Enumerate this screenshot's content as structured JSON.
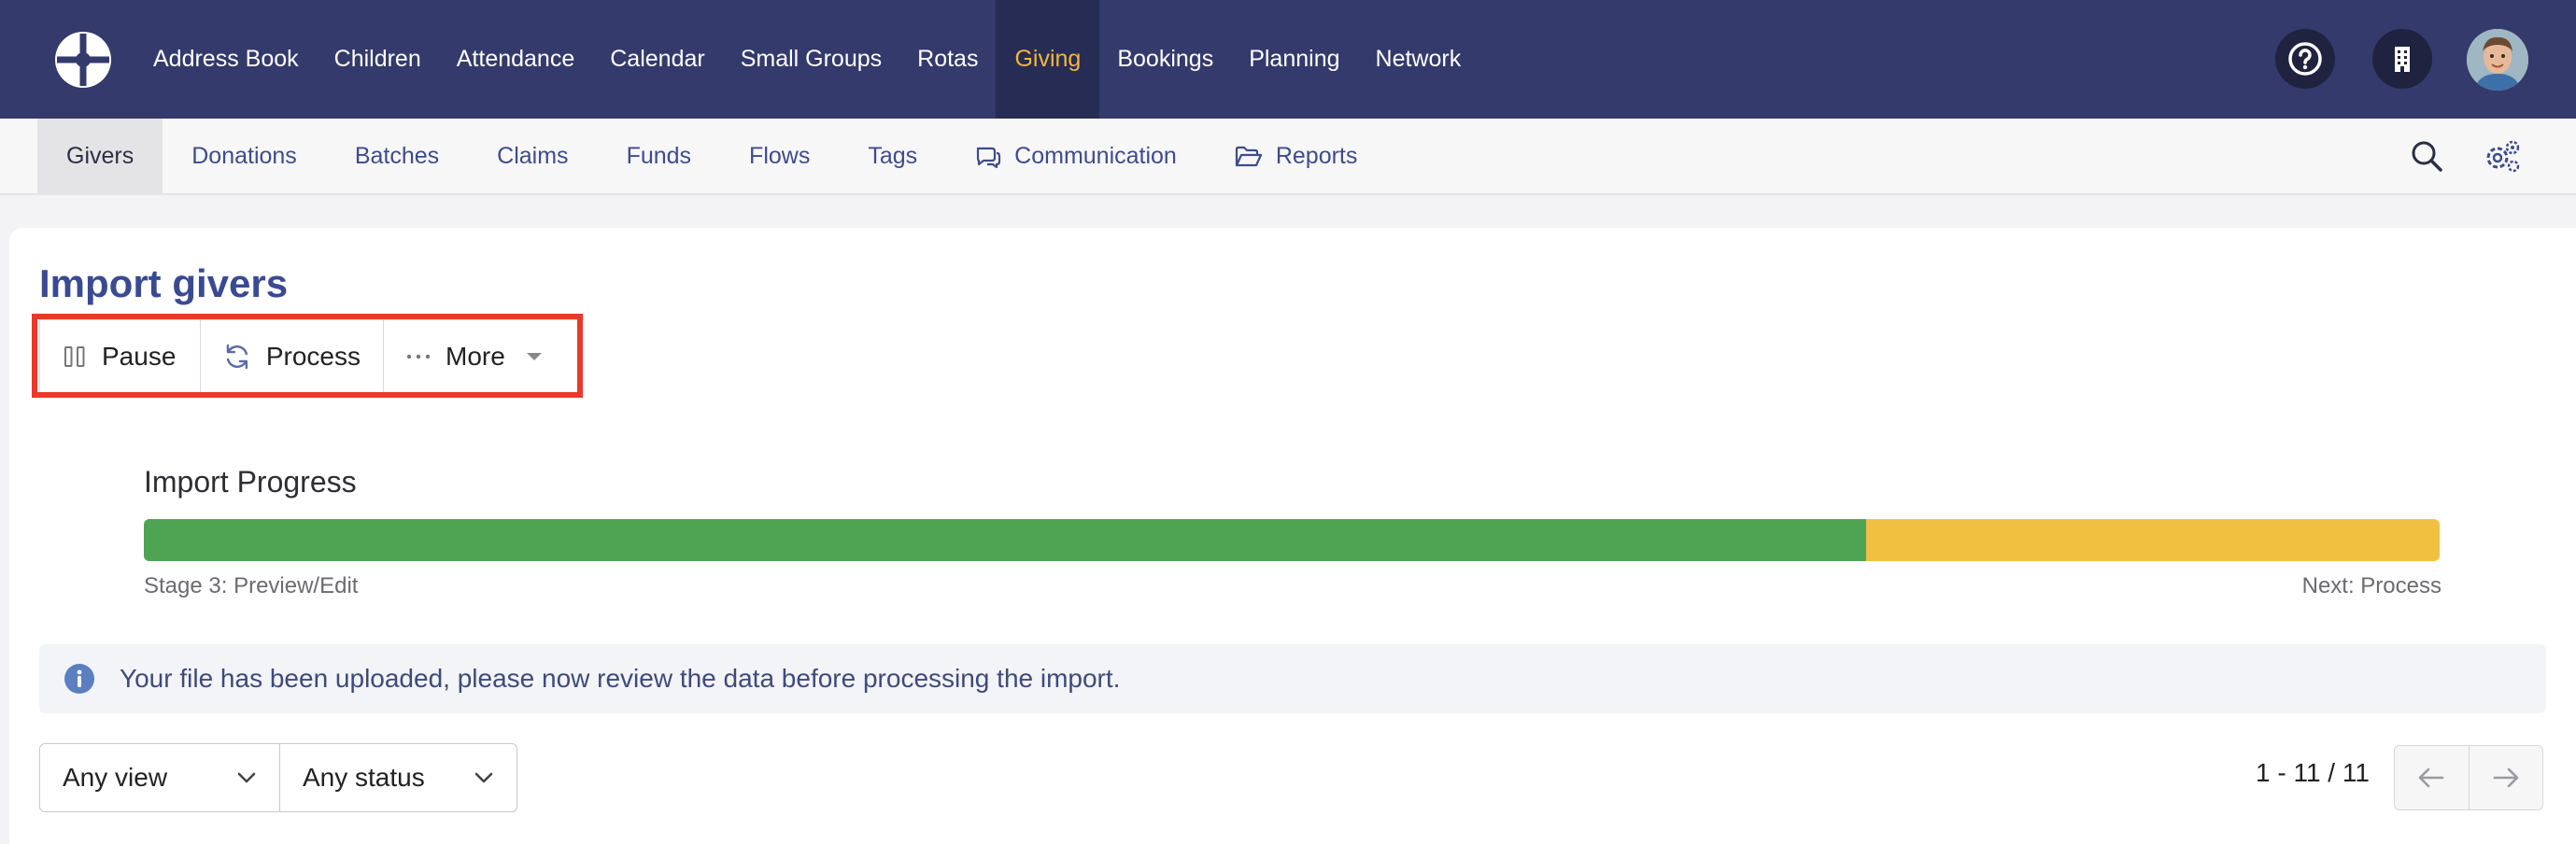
{
  "topnav": {
    "items": [
      {
        "label": "Address Book"
      },
      {
        "label": "Children"
      },
      {
        "label": "Attendance"
      },
      {
        "label": "Calendar"
      },
      {
        "label": "Small Groups"
      },
      {
        "label": "Rotas"
      },
      {
        "label": "Giving",
        "active": true
      },
      {
        "label": "Bookings"
      },
      {
        "label": "Planning"
      },
      {
        "label": "Network"
      }
    ],
    "icons": [
      "help-icon",
      "building-icon",
      "avatar"
    ],
    "active_color": "#f2b63c",
    "background": "#343a6b"
  },
  "subnav": {
    "items": [
      {
        "label": "Givers",
        "active": true
      },
      {
        "label": "Donations"
      },
      {
        "label": "Batches"
      },
      {
        "label": "Claims"
      },
      {
        "label": "Funds"
      },
      {
        "label": "Flows"
      },
      {
        "label": "Tags"
      },
      {
        "label": "Communication",
        "icon": "chat-icon"
      },
      {
        "label": "Reports",
        "icon": "folder-open-icon"
      }
    ],
    "right_icons": [
      "search-icon",
      "settings-icon"
    ]
  },
  "page": {
    "title": "Import givers"
  },
  "toolbar": {
    "pause_label": "Pause",
    "process_label": "Process",
    "more_label": "More"
  },
  "progress": {
    "label": "Import Progress",
    "complete_fraction": 0.75,
    "stage_text": "Stage 3: Preview/Edit",
    "next_text": "Next: Process",
    "complete_color": "#4fa453",
    "remaining_color": "#f1c040"
  },
  "info": {
    "message": "Your file has been uploaded, please now review the data before processing the import."
  },
  "filters": {
    "view_value": "Any view",
    "status_value": "Any status"
  },
  "pagination": {
    "text": "1 - 11 / 11"
  }
}
